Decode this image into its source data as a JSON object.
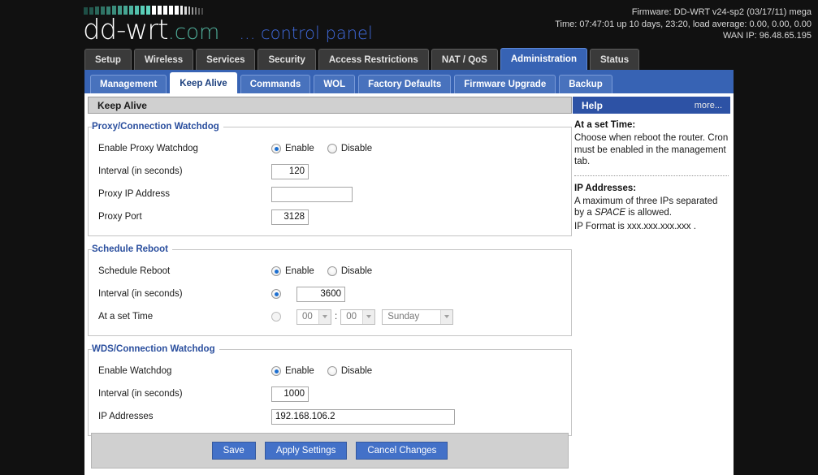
{
  "header": {
    "logo_main": "dd-wrt",
    "logo_suffix": ".com",
    "tagline": "... control panel",
    "firmware_line": "Firmware: DD-WRT v24-sp2 (03/17/11) mega",
    "time_line": "Time: 07:47:01 up 10 days, 23:20, load average: 0.00, 0.00, 0.00",
    "wan_line": "WAN IP: 96.48.65.195"
  },
  "main_tabs": [
    {
      "label": "Setup",
      "active": false
    },
    {
      "label": "Wireless",
      "active": false
    },
    {
      "label": "Services",
      "active": false
    },
    {
      "label": "Security",
      "active": false
    },
    {
      "label": "Access Restrictions",
      "active": false
    },
    {
      "label": "NAT / QoS",
      "active": false
    },
    {
      "label": "Administration",
      "active": true
    },
    {
      "label": "Status",
      "active": false
    }
  ],
  "sub_tabs": [
    {
      "label": "Management",
      "active": false
    },
    {
      "label": "Keep Alive",
      "active": true
    },
    {
      "label": "Commands",
      "active": false
    },
    {
      "label": "WOL",
      "active": false
    },
    {
      "label": "Factory Defaults",
      "active": false
    },
    {
      "label": "Firmware Upgrade",
      "active": false
    },
    {
      "label": "Backup",
      "active": false
    }
  ],
  "panel": {
    "title": "Keep Alive"
  },
  "proxy_watchdog": {
    "legend": "Proxy/Connection Watchdog",
    "enable_label": "Enable Proxy Watchdog",
    "radio_enable": "Enable",
    "radio_disable": "Disable",
    "selected": "Enable",
    "interval_label": "Interval (in seconds)",
    "interval_value": "120",
    "ip_label": "Proxy IP Address",
    "ip_value": "",
    "port_label": "Proxy Port",
    "port_value": "3128"
  },
  "schedule_reboot": {
    "legend": "Schedule Reboot",
    "enable_label": "Schedule Reboot",
    "radio_enable": "Enable",
    "radio_disable": "Disable",
    "selected": "Enable",
    "interval_label": "Interval (in seconds)",
    "interval_value": "3600",
    "interval_mode_selected": true,
    "settime_label": "At a set Time",
    "settime_mode_selected": false,
    "hour_value": "00",
    "minute_value": "00",
    "colon": ":",
    "day_value": "Sunday"
  },
  "wds_watchdog": {
    "legend": "WDS/Connection Watchdog",
    "enable_label": "Enable Watchdog",
    "radio_enable": "Enable",
    "radio_disable": "Disable",
    "selected": "Enable",
    "interval_label": "Interval (in seconds)",
    "interval_value": "1000",
    "ips_label": "IP Addresses",
    "ips_value": "192.168.106.2"
  },
  "help": {
    "title": "Help",
    "more_label": "more...",
    "section1_title": "At a set Time:",
    "section1_body": "Choose when reboot the router. Cron must be enabled in the management tab.",
    "section2_title": "IP Addresses:",
    "section2_line1_a": "A maximum of three IPs separated by a ",
    "section2_line1_italic": "SPACE",
    "section2_line1_b": " is allowed.",
    "section2_line2": "IP Format is xxx.xxx.xxx.xxx ."
  },
  "buttons": {
    "save": "Save",
    "apply": "Apply Settings",
    "cancel": "Cancel Changes"
  },
  "colors": {
    "accent_blue": "#3763b4",
    "help_header_blue": "#2d52a5",
    "button_blue": "#4371c8",
    "legend_blue": "#2b4f9e",
    "logo_teal": "#4fae9a",
    "tagline_blue": "#3f68d8",
    "page_black": "#111111"
  }
}
